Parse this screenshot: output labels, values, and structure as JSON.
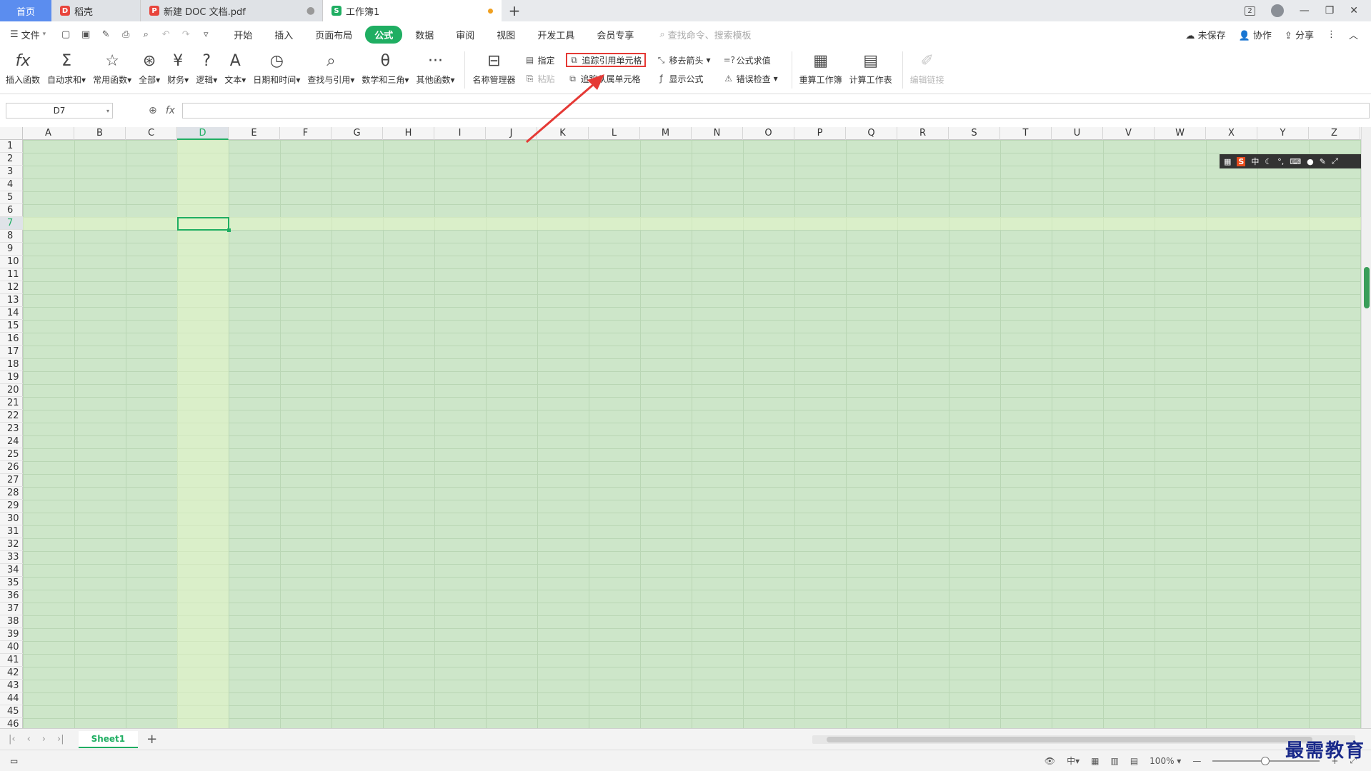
{
  "tabs": {
    "home": "首页",
    "doc": "稻壳",
    "pdf": "新建 DOC 文档.pdf",
    "workbook": "工作簿1"
  },
  "menu": {
    "file": "文件",
    "tabs": [
      "开始",
      "插入",
      "页面布局",
      "公式",
      "数据",
      "审阅",
      "视图",
      "开发工具",
      "会员专享"
    ],
    "active_tab": "公式",
    "search_placeholder": "查找命令、搜索模板",
    "unsaved": "未保存",
    "collaborate": "协作",
    "share": "分享"
  },
  "ribbon": {
    "insert_function": "插入函数",
    "autosum": "自动求和",
    "common": "常用函数",
    "all": "全部",
    "finance": "财务",
    "logic": "逻辑",
    "text": "文本",
    "datetime": "日期和时间",
    "lookup": "查找与引用",
    "math": "数学和三角",
    "other": "其他函数",
    "name_manager": "名称管理器",
    "specify": "指定",
    "paste": "粘贴",
    "trace_precedents": "追踪引用单元格",
    "trace_dependents": "追踪从属单元格",
    "remove_arrows": "移去箭头",
    "show_formulas": "显示公式",
    "evaluate": "公式求值",
    "error_check": "错误检查",
    "recalc_workbook": "重算工作簿",
    "calc_sheet": "计算工作表",
    "edit_links": "编辑链接"
  },
  "formula_bar": {
    "cell_ref": "D7",
    "fx": "fx"
  },
  "grid": {
    "columns": [
      "A",
      "B",
      "C",
      "D",
      "E",
      "F",
      "G",
      "H",
      "I",
      "J",
      "K",
      "L",
      "M",
      "N",
      "O",
      "P",
      "Q",
      "R",
      "S",
      "T",
      "U",
      "V",
      "W",
      "X",
      "Y",
      "Z"
    ],
    "selected_column": "D",
    "selected_row": 7,
    "row_count": 46
  },
  "sheet": {
    "name": "Sheet1"
  },
  "status": {
    "zoom": "100%"
  },
  "watermark": "最需教育",
  "colors": {
    "accent": "#1fae62",
    "sheet_bg": "#cde6c9",
    "annotation": "#e53935"
  }
}
